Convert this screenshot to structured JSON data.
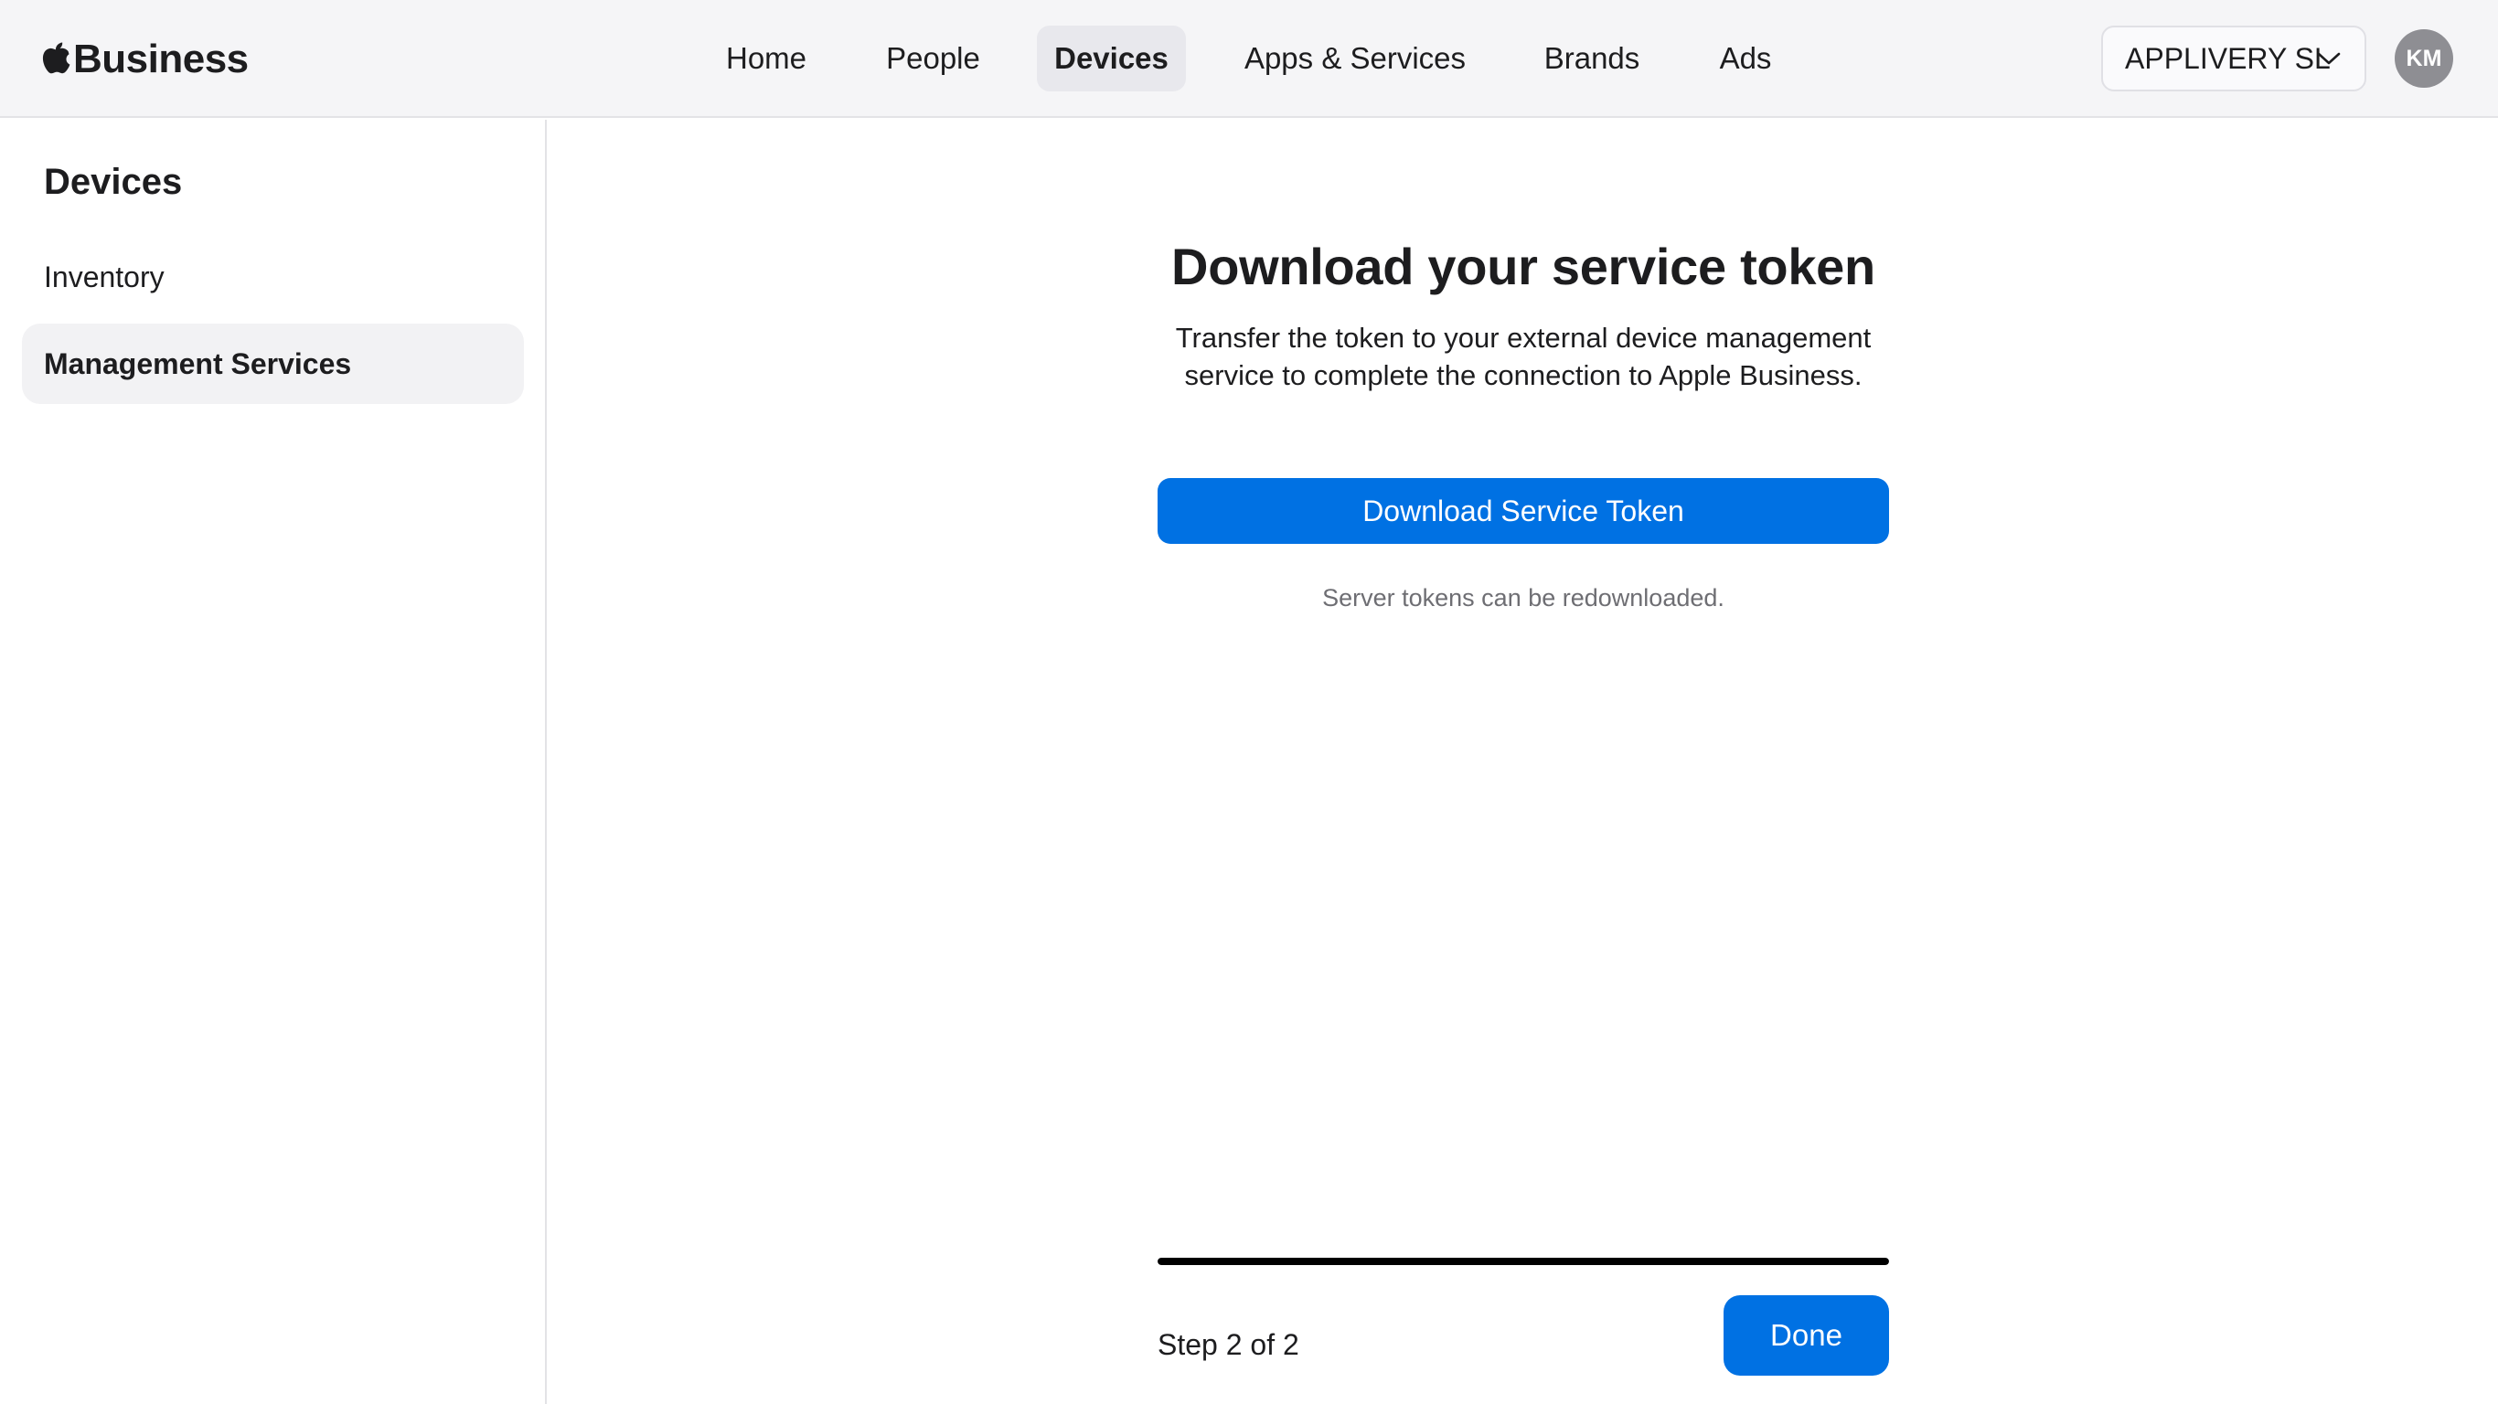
{
  "header": {
    "brand": {
      "logo_icon": "apple-logo-icon",
      "name": "Business"
    },
    "nav": [
      {
        "label": "Home",
        "active": false
      },
      {
        "label": "People",
        "active": false
      },
      {
        "label": "Devices",
        "active": true
      },
      {
        "label": "Apps & Services",
        "active": false
      },
      {
        "label": "Brands",
        "active": false
      },
      {
        "label": "Ads",
        "active": false
      }
    ],
    "org_selector": {
      "value": "APPLIVERY SL",
      "icon": "chevron-down-icon"
    },
    "avatar": {
      "initials": "KM",
      "color": "#8e8e93"
    }
  },
  "sidebar": {
    "title": "Devices",
    "items": [
      {
        "label": "Inventory",
        "active": false
      },
      {
        "label": "Management Services",
        "active": true
      }
    ]
  },
  "main": {
    "headline": "Download your service token",
    "subtitle": "Transfer the token to your external device management service to complete the connection to Apple Business.",
    "download_button_label": "Download Service Token",
    "hint": "Server tokens can be redownloaded.",
    "progress": {
      "current_step": 2,
      "total_steps": 2,
      "fraction": 1.0
    },
    "step_label": "Step 2 of 2",
    "done_button_label": "Done"
  },
  "colors": {
    "accent": "#0071e3",
    "topbar_bg": "#f5f5f7",
    "active_nav_bg": "#e8e8ed",
    "text": "#1d1d1f",
    "secondary_text": "#6e6e73"
  }
}
